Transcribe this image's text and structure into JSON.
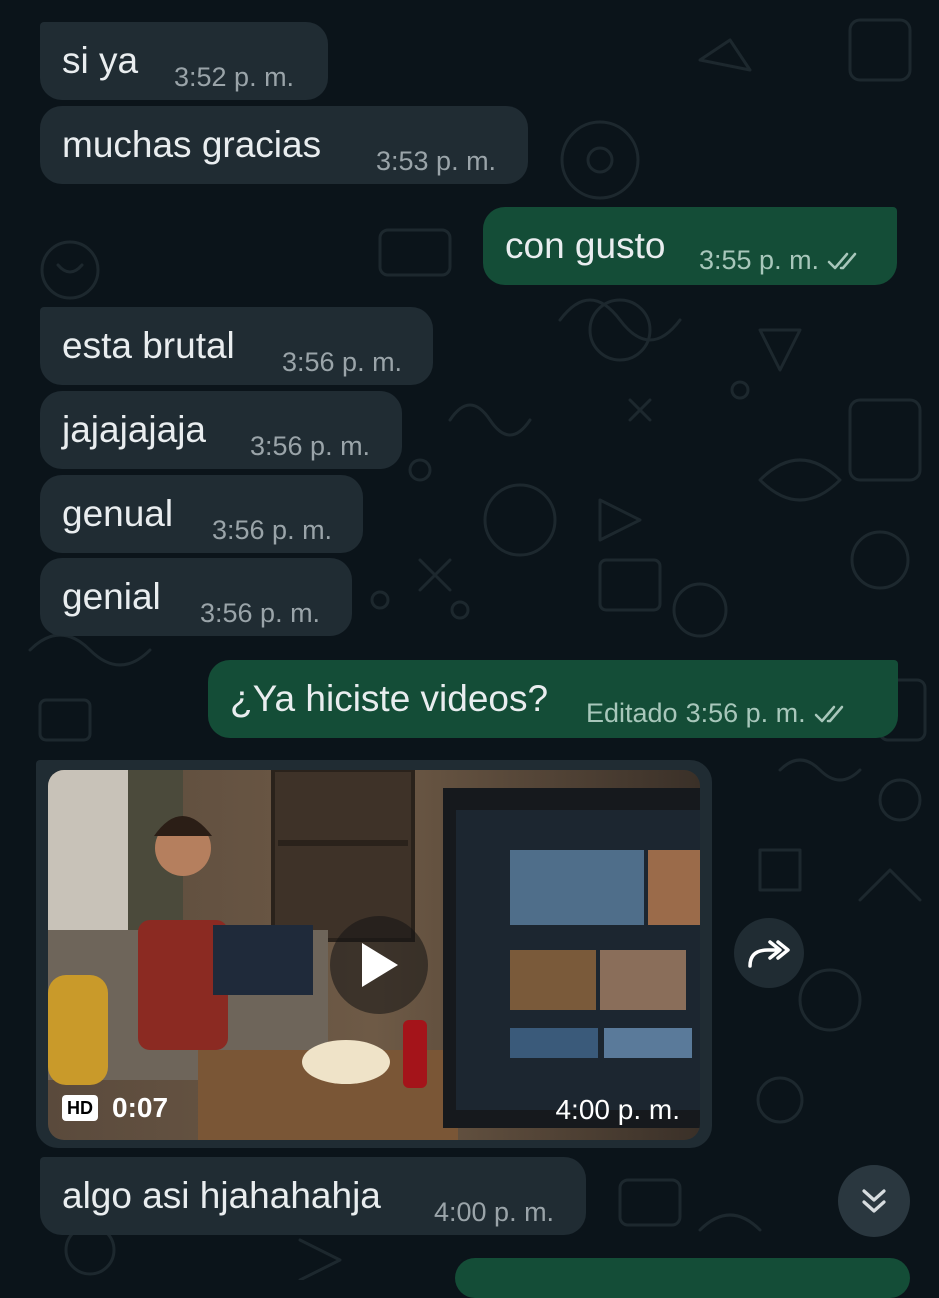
{
  "theme": {
    "incoming_bubble": "#202c33",
    "outgoing_bubble": "#144d37",
    "background": "#0b141a",
    "read_receipt": "#a8c7bb"
  },
  "messages": [
    {
      "direction": "in",
      "text": "si ya",
      "time": "3:52 p. m."
    },
    {
      "direction": "in",
      "text": "muchas gracias",
      "time": "3:53 p. m."
    },
    {
      "direction": "out",
      "text": "con gusto",
      "time": "3:55 p. m.",
      "status": "read-double-check"
    },
    {
      "direction": "in",
      "text": "esta brutal",
      "time": "3:56 p. m."
    },
    {
      "direction": "in",
      "text": "jajajajaja",
      "time": "3:56 p. m."
    },
    {
      "direction": "in",
      "text": "genual",
      "time": "3:56 p. m."
    },
    {
      "direction": "in",
      "text": "genial",
      "time": "3:56 p. m."
    },
    {
      "direction": "out",
      "text": "¿Ya hiciste videos?",
      "edited_label": "Editado",
      "time": "3:56 p. m.",
      "status": "read-double-check"
    },
    {
      "direction": "in",
      "type": "video",
      "quality_badge": "HD",
      "duration": "0:07",
      "time": "4:00 p. m."
    },
    {
      "direction": "in",
      "text": "algo asi hjahahahja",
      "time": "4:00 p. m."
    }
  ],
  "icons": {
    "forward": "forward-arrow-icon",
    "scroll_down": "double-chevron-down-icon",
    "play": "play-icon"
  }
}
